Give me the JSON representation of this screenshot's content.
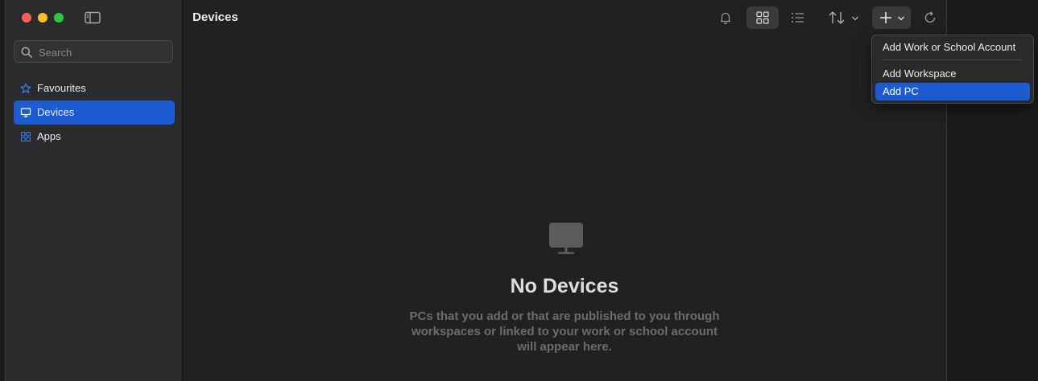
{
  "window": {
    "title": "Devices"
  },
  "sidebar": {
    "search_placeholder": "Search",
    "items": [
      {
        "label": "Favourites",
        "icon": "star-icon",
        "active": false
      },
      {
        "label": "Devices",
        "icon": "monitor-icon",
        "active": true
      },
      {
        "label": "Apps",
        "icon": "apps-grid-icon",
        "active": false
      }
    ]
  },
  "toolbar": {
    "buttons": [
      "bell-icon",
      "grid-view-icon",
      "list-view-icon",
      "sort-icon",
      "add-icon",
      "refresh-icon"
    ],
    "selected_view": "grid"
  },
  "empty_state": {
    "title": "No Devices",
    "description": "PCs that you add or that are published to you through workspaces or linked to your work or school account will appear here."
  },
  "add_menu": {
    "items": [
      {
        "label": "Add Work or School Account"
      },
      {
        "label": "Add Workspace"
      },
      {
        "label": "Add PC",
        "highlighted": true
      }
    ]
  },
  "colors": {
    "accent": "#1c5bd1",
    "close": "#fe5f57",
    "minimize": "#febc2e",
    "maximize": "#28c840",
    "icon_accent": "#3b82f6"
  }
}
